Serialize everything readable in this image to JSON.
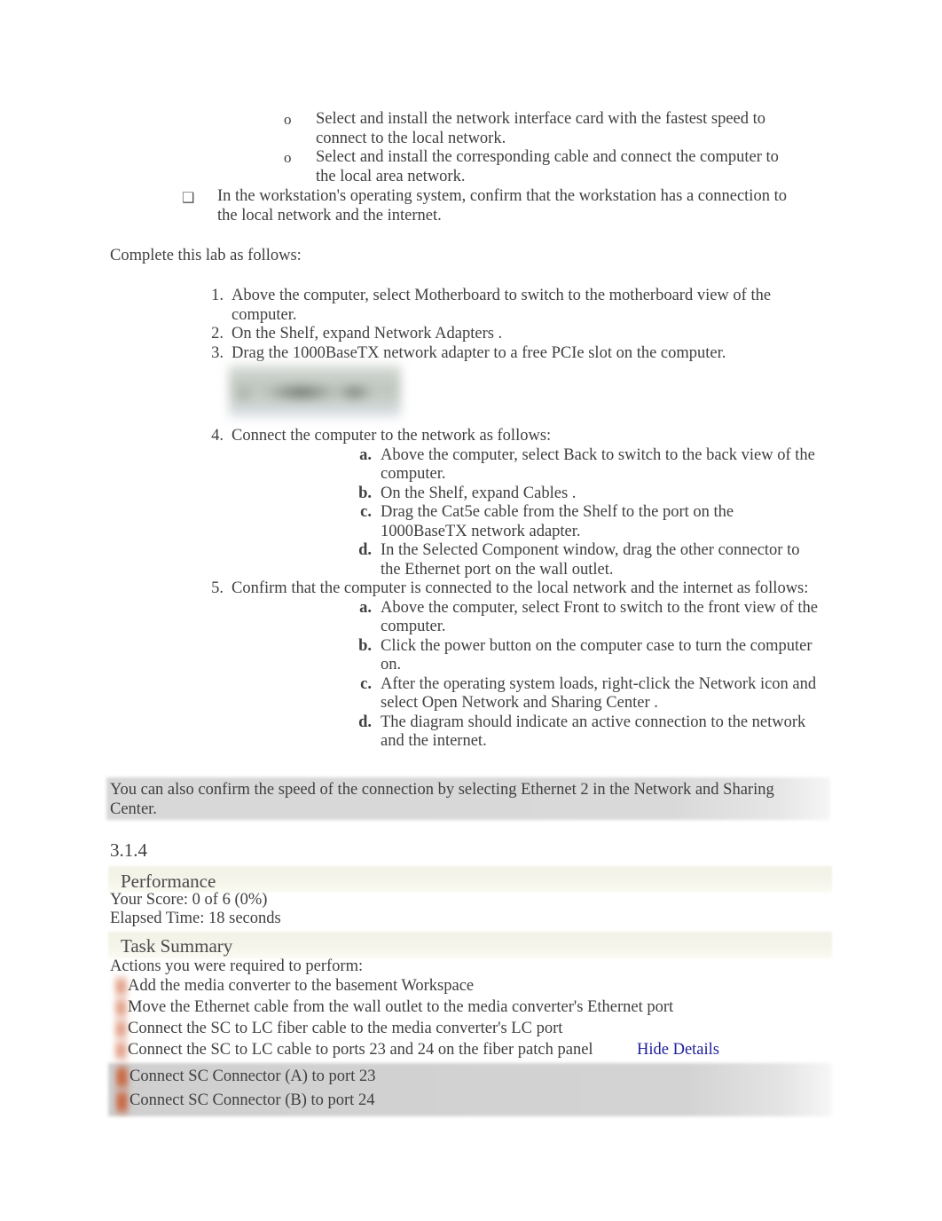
{
  "document": {
    "top_bullets_level3": [
      {
        "marker": "o",
        "text": "Select and install the network interface card with the fastest speed to connect to the local network."
      },
      {
        "marker": "o",
        "text": "Select and install the corresponding cable and connect the computer to the local area network."
      }
    ],
    "top_bullets_level2": [
      {
        "marker": "❑",
        "text": "In the workstation's operating system, confirm that the workstation has a connection to the local network and the internet."
      }
    ],
    "intro_line": "Complete this lab as follows:",
    "steps": [
      {
        "marker": "1.",
        "text": "Above the computer, select     Motherboard    to switch to the motherboard view of the computer.",
        "substeps": []
      },
      {
        "marker": "2.",
        "text": "On the Shelf, expand    Network Adapters    .",
        "substeps": []
      },
      {
        "marker": "3.",
        "text": "Drag the  1000BaseTX network adapter       to a free PCIe slot on the computer.",
        "substeps": []
      },
      {
        "marker": "4.",
        "text": "Connect the computer to the network as follows:",
        "substeps": [
          {
            "marker": "a.",
            "text": "Above the computer, select     Back  to switch to the back view of the computer."
          },
          {
            "marker": "b.",
            "text": "On the Shelf, expand    Cables  ."
          },
          {
            "marker": "c.",
            "text": "Drag the  Cat5e cable    from the Shelf to the port on the 1000BaseTX network adapter."
          },
          {
            "marker": "d.",
            "text": "In the Selected Component window, drag the other        connector    to the Ethernet port on the wall outlet."
          }
        ]
      },
      {
        "marker": "5.",
        "text": "Confirm that the computer is connected to the local network and the internet as follows:",
        "substeps": [
          {
            "marker": "a.",
            "text": "Above the computer, select      Front  to switch to the front view of the computer."
          },
          {
            "marker": "b.",
            "text": "Click the  power button    on the computer case to turn the computer on."
          },
          {
            "marker": "c.",
            "text": "After the operating system loads, right-click the       Network   icon and select  Open Network and Sharing Center        ."
          },
          {
            "marker": "d.",
            "text": "The diagram should indicate an active connection to the network and the internet."
          }
        ]
      }
    ],
    "note": "You can also confirm the speed of the connection by selecting         Ethernet 2    in the Network and Sharing Center.",
    "section_number": "3.1.4"
  },
  "performance": {
    "heading": "Performance",
    "score_line": "Your Score: 0 of 6 (0%)",
    "elapsed_line": "Elapsed Time: 18 seconds"
  },
  "task_summary": {
    "heading": "Task Summary",
    "subheading": "Actions you were required to perform:",
    "items": [
      {
        "text": "Add the media converter to the basement Workspace",
        "status": "incorrect"
      },
      {
        "text": "Move the Ethernet cable from the wall outlet to the media converter's Ethernet port",
        "status": "incorrect"
      },
      {
        "text": "Connect the SC to LC fiber cable to the media converter's LC port",
        "status": "incorrect"
      },
      {
        "text": "Connect the SC to LC cable to ports 23 and 24 on the fiber patch panel",
        "status": "incorrect"
      }
    ],
    "hide_details_label": "Hide Details",
    "detail_items": [
      {
        "text": "Connect SC Connector (A) to port 23",
        "status": "incorrect"
      },
      {
        "text": "Connect SC Connector (B) to port 24",
        "status": "incorrect"
      }
    ]
  },
  "colors": {
    "text": "#3f3f3f",
    "link": "#1f1f9e",
    "note_band": "#d9d9d9",
    "section_band": "#f2f2e7",
    "incorrect_marker": "#c9643e"
  }
}
